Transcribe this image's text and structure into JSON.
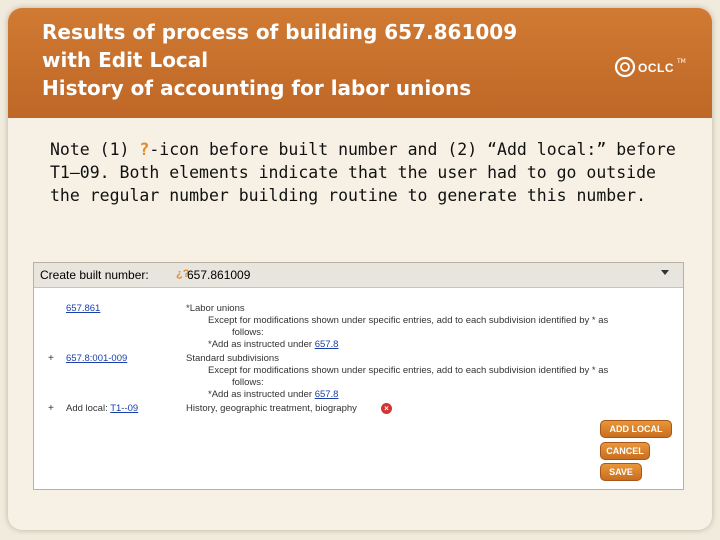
{
  "slide": {
    "title_lines": [
      "Results of process of building 657.861009",
      "with Edit Local",
      "History of accounting for labor unions"
    ],
    "logo_text": "OCLC",
    "logo_tm": "TM",
    "note": {
      "part1": "Note (1) ",
      "icon": "?",
      "part2": "-icon before built number and (2) “Add local:” before T1—09.  Both elements indicate that the user had to go outside the regular number building routine to generate this number."
    }
  },
  "panel": {
    "header_label": "Create built number:",
    "header_icon": "¿?",
    "header_number": "657.861009",
    "rows": [
      {
        "plus": "",
        "link_prefix": "",
        "link": "657.861",
        "desc": "*Labor unions"
      },
      {
        "desc": "Except for modifications shown under specific entries, add to each subdivision identified by * as"
      },
      {
        "desc": "follows:"
      },
      {
        "desc_prefix": "*Add as instructed under ",
        "desc_link": "657.8"
      },
      {
        "plus": "+",
        "link": "657.8:001-009",
        "desc": "Standard subdivisions"
      },
      {
        "desc": "Except for modifications shown under specific entries, add to each subdivision identified by * as"
      },
      {
        "desc": "follows:"
      },
      {
        "desc_prefix": "*Add as instructed under ",
        "desc_link": "657.8"
      },
      {
        "plus": "+",
        "link_prefix": "Add local: ",
        "link": "T1--09",
        "desc": "History, geographic treatment, biography"
      }
    ],
    "buttons": {
      "add_local": "ADD LOCAL",
      "cancel": "CANCEL",
      "save": "SAVE"
    }
  }
}
